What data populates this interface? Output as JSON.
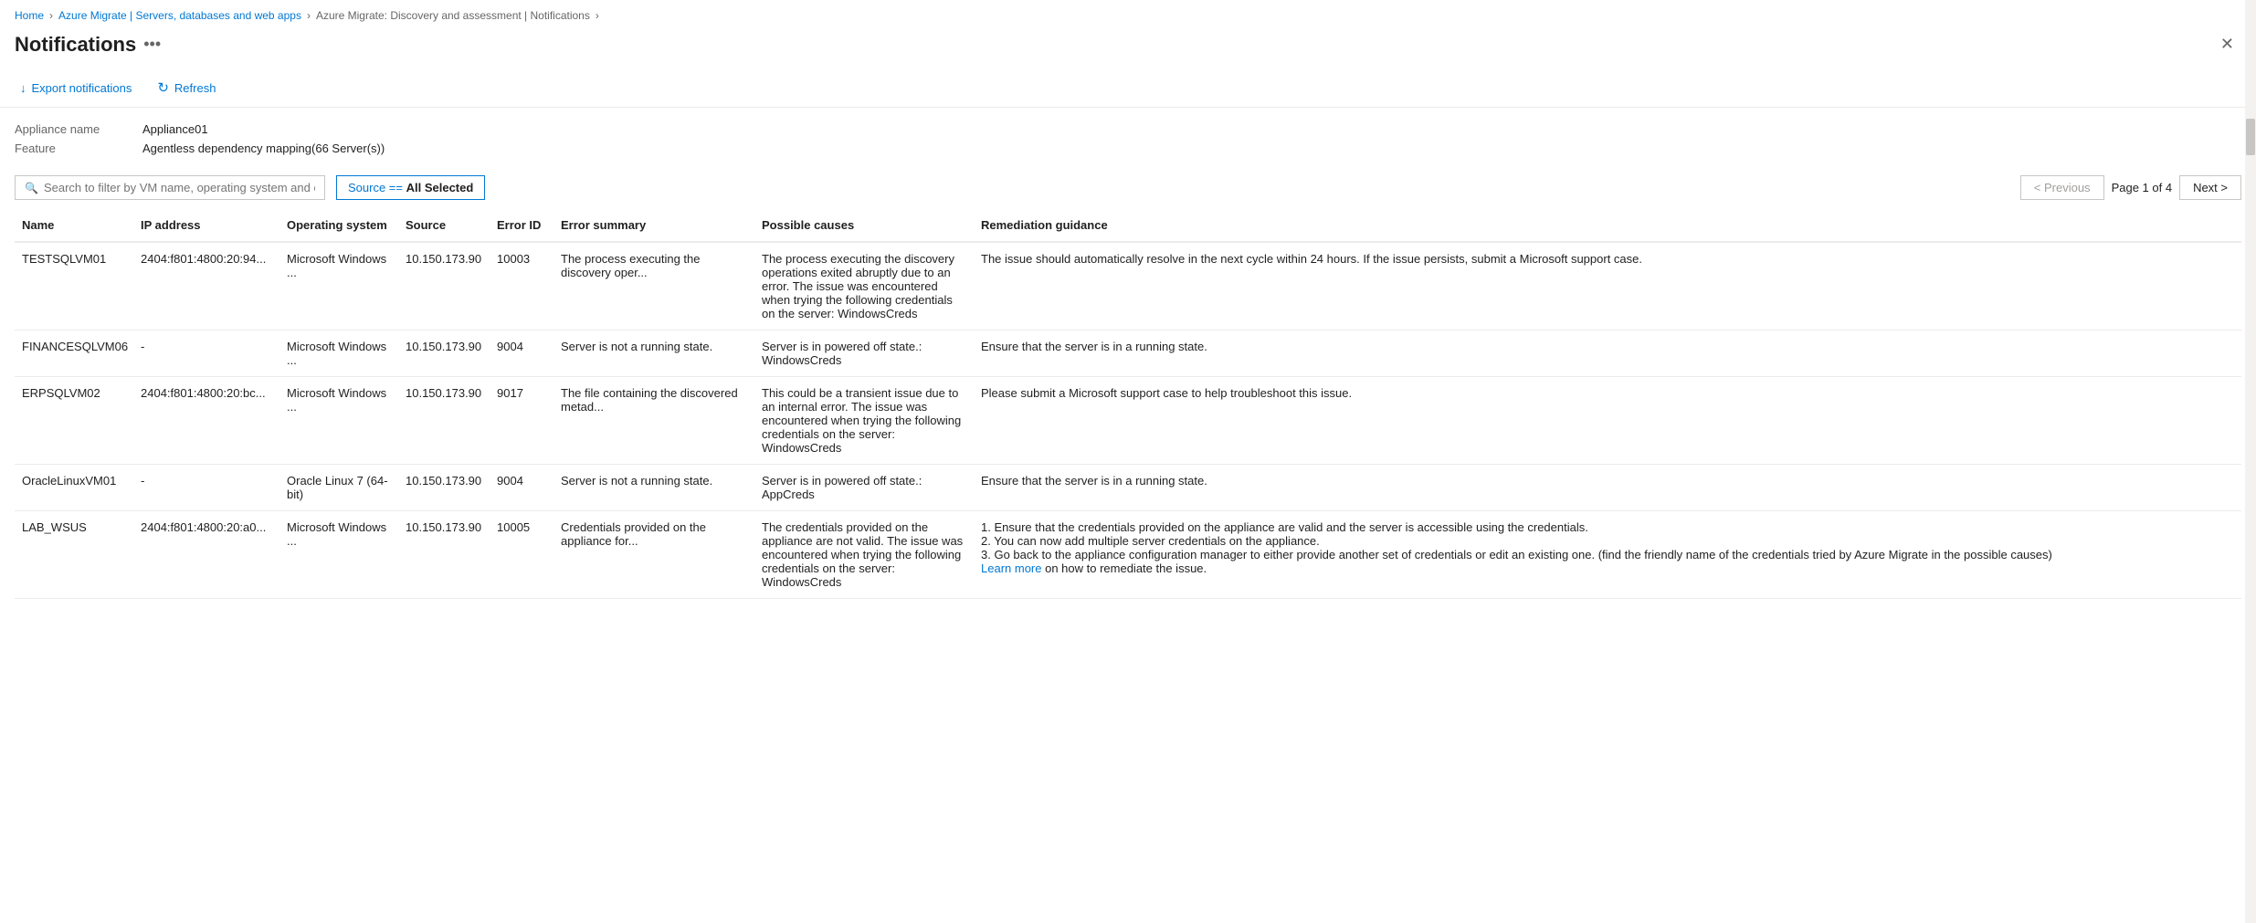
{
  "breadcrumb": {
    "items": [
      {
        "label": "Home",
        "active": true
      },
      {
        "label": "Azure Migrate | Servers, databases and web apps",
        "active": true
      },
      {
        "label": "Azure Migrate: Discovery and assessment | Notifications",
        "active": false
      }
    ]
  },
  "header": {
    "title": "Notifications",
    "more_icon": "•••"
  },
  "toolbar": {
    "export_label": "Export notifications",
    "refresh_label": "Refresh"
  },
  "meta": {
    "appliance_label": "Appliance name",
    "appliance_value": "Appliance01",
    "feature_label": "Feature",
    "feature_value": "Agentless dependency mapping(66 Server(s))"
  },
  "filter": {
    "search_placeholder": "Search to filter by VM name, operating system and error ID",
    "source_filter_label": "Source == All Selected"
  },
  "pagination": {
    "previous_label": "< Previous",
    "next_label": "Next >",
    "page_info": "Page 1 of 4"
  },
  "table": {
    "columns": [
      {
        "key": "name",
        "label": "Name"
      },
      {
        "key": "ip",
        "label": "IP address"
      },
      {
        "key": "os",
        "label": "Operating system"
      },
      {
        "key": "source",
        "label": "Source"
      },
      {
        "key": "error_id",
        "label": "Error ID"
      },
      {
        "key": "summary",
        "label": "Error summary"
      },
      {
        "key": "causes",
        "label": "Possible causes"
      },
      {
        "key": "remediation",
        "label": "Remediation guidance"
      }
    ],
    "rows": [
      {
        "name": "TESTSQLVM01",
        "ip": "2404:f801:4800:20:94...",
        "os": "Microsoft Windows ...",
        "source": "10.150.173.90",
        "error_id": "10003",
        "summary": "The process executing the discovery oper...",
        "causes": "The process executing the discovery operations exited abruptly due to an error. The issue was encountered when trying the following credentials on the server: WindowsCreds",
        "remediation": "The issue should automatically resolve in the next cycle within 24 hours. If the issue persists, submit a Microsoft support case."
      },
      {
        "name": "FINANCESQLVM06",
        "ip": "-",
        "os": "Microsoft Windows ...",
        "source": "10.150.173.90",
        "error_id": "9004",
        "summary": "Server is not a running state.",
        "causes": "Server is in powered off state.: WindowsCreds",
        "remediation": "Ensure that the server is in a running state."
      },
      {
        "name": "ERPSQLVM02",
        "ip": "2404:f801:4800:20:bc...",
        "os": "Microsoft Windows ...",
        "source": "10.150.173.90",
        "error_id": "9017",
        "summary": "The file containing the discovered metad...",
        "causes": "This could be a transient issue due to an internal error. The issue was encountered when trying the following credentials on the server: WindowsCreds",
        "remediation": "Please submit a Microsoft support case to help troubleshoot this issue."
      },
      {
        "name": "OracleLinuxVM01",
        "ip": "-",
        "os": "Oracle Linux 7 (64-bit)",
        "source": "10.150.173.90",
        "error_id": "9004",
        "summary": "Server is not a running state.",
        "causes": "Server is in powered off state.: AppCreds",
        "remediation": "Ensure that the server is in a running state."
      },
      {
        "name": "LAB_WSUS",
        "ip": "2404:f801:4800:20:a0...",
        "os": "Microsoft Windows ...",
        "source": "10.150.173.90",
        "error_id": "10005",
        "summary": "Credentials provided on the appliance for...",
        "causes": "The credentials provided on the appliance are not valid. The issue was encountered when trying the following credentials on the server: WindowsCreds",
        "remediation": "1. Ensure that the credentials provided on the appliance are valid and the server is accessible using the credentials.\n2. You can now add multiple server credentials on the appliance.\n3. Go back to the appliance configuration manager to either provide another set of credentials or edit an existing one. (find the friendly name of the credentials tried by Azure Migrate in the possible causes)",
        "remediation_link": "Learn more",
        "remediation_link_suffix": " on how to remediate the issue."
      }
    ]
  }
}
